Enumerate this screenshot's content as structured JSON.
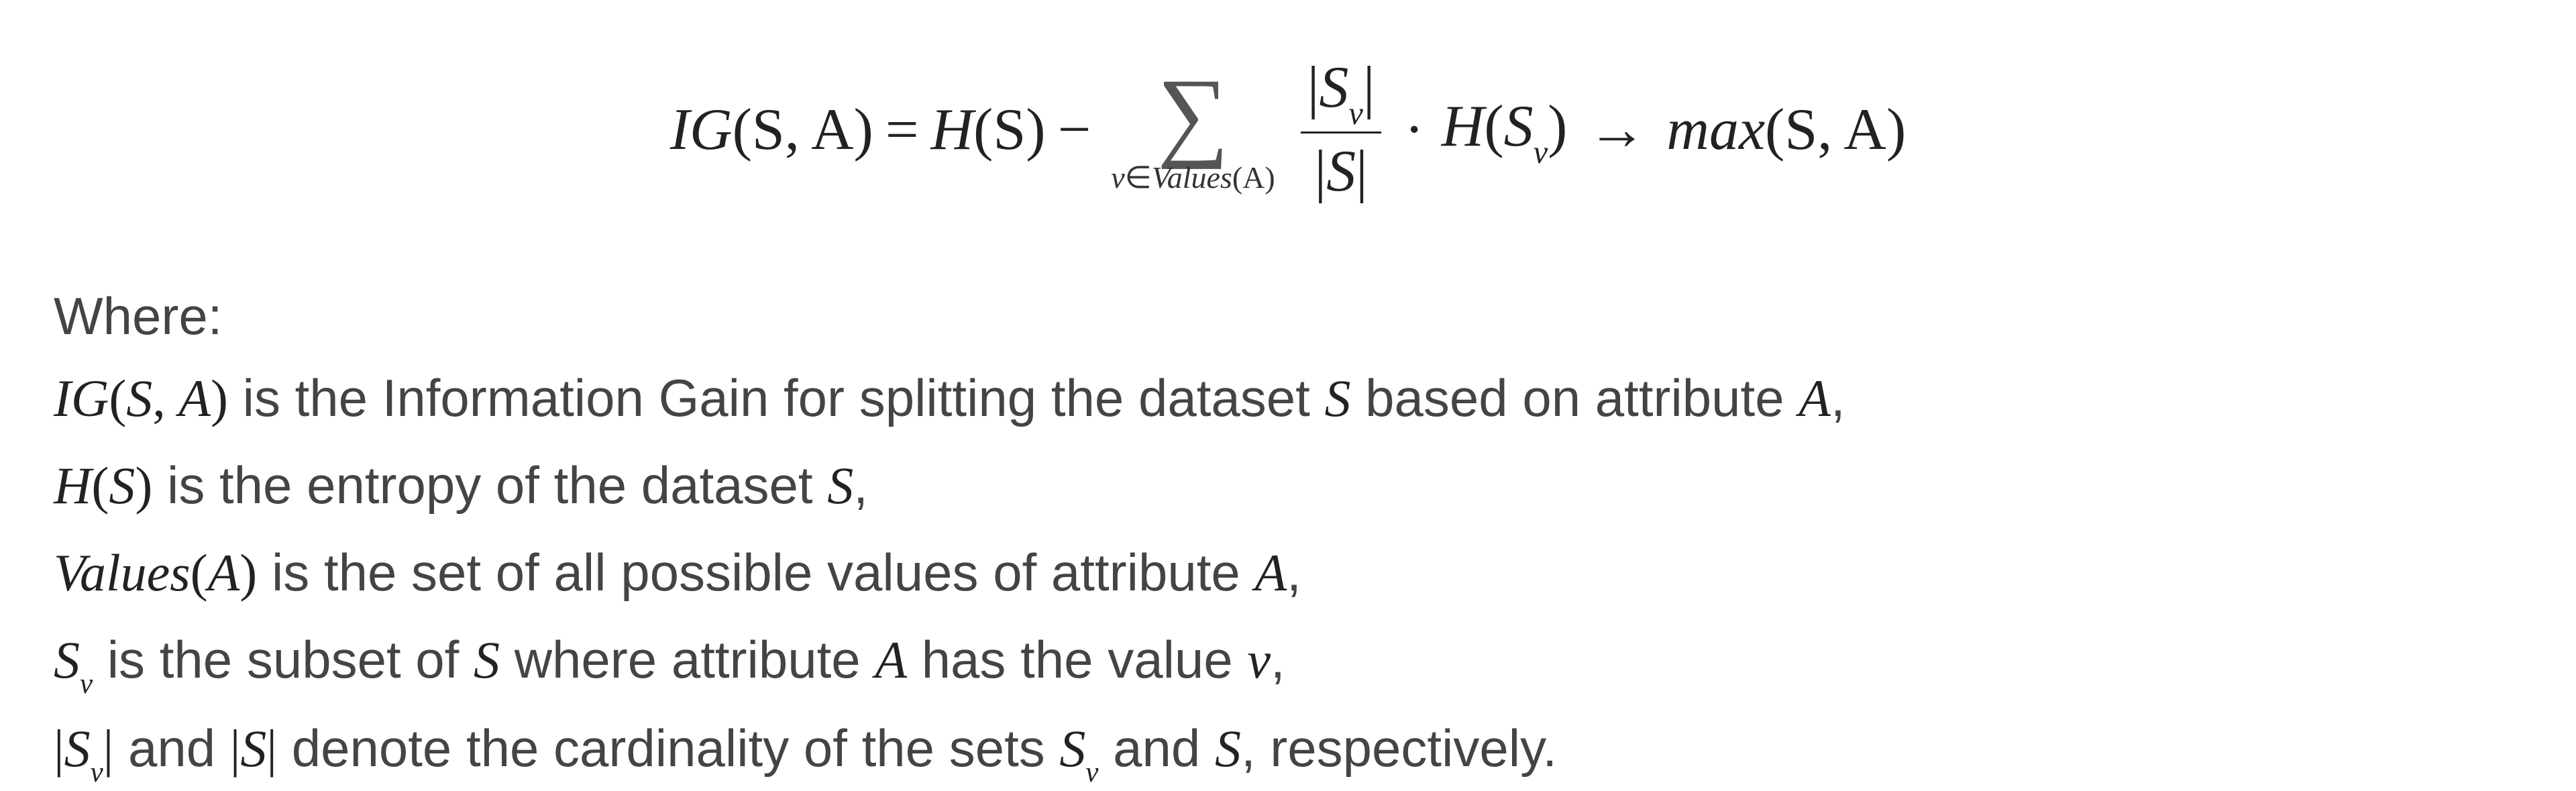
{
  "formula": {
    "lhs_func": "IG",
    "lhs_args": "(S, A)",
    "eq": "=",
    "H": "H",
    "S_arg": "(S)",
    "minus": "−",
    "sigma_sub_prefix": "v",
    "sigma_sub_rel": "∈",
    "sigma_sub_func": "Values",
    "sigma_sub_arg": "(A)",
    "frac_num_bar_l": "|",
    "frac_num_S": "S",
    "frac_num_sub": "v",
    "frac_num_bar_r": "|",
    "frac_den_bar_l": "|",
    "frac_den_S": "S",
    "frac_den_bar_r": "|",
    "dot": "·",
    "H2": "H",
    "Sv_arg_open": "(",
    "Sv_S": "S",
    "Sv_sub": "v",
    "Sv_arg_close": ")",
    "arrow": "→",
    "max": "max",
    "max_args": "(S, A)"
  },
  "where_label": "Where:",
  "defs": {
    "line1": {
      "m1": "IG(S, A)",
      "t1": " is the Information Gain for splitting the dataset ",
      "m2": "S",
      "t2": " based on attribute ",
      "m3": "A",
      "t3": ","
    },
    "line2": {
      "m1": "H(S)",
      "t1": " is the entropy of the dataset ",
      "m2": "S",
      "t2": ","
    },
    "line3": {
      "m1": "Values(A)",
      "t1": " is the set of all possible values of attribute ",
      "m2": "A",
      "t2": ","
    },
    "line4": {
      "m1_S": "S",
      "m1_sub": "v",
      "t1": " is the subset of ",
      "m2": "S",
      "t2": " where attribute ",
      "m3": "A",
      "t3": " has the value ",
      "m4": "v",
      "t4": ","
    },
    "line5": {
      "m1_bar_l": "|",
      "m1_S": "S",
      "m1_sub": "v",
      "m1_bar_r": "|",
      "t1": " and ",
      "m2_bar_l": "|",
      "m2_S": "S",
      "m2_bar_r": "|",
      "t2": " denote the cardinality of the sets ",
      "m3_S": "S",
      "m3_sub": "v",
      "t3": " and ",
      "m4": "S",
      "t4": ", respectively."
    }
  }
}
